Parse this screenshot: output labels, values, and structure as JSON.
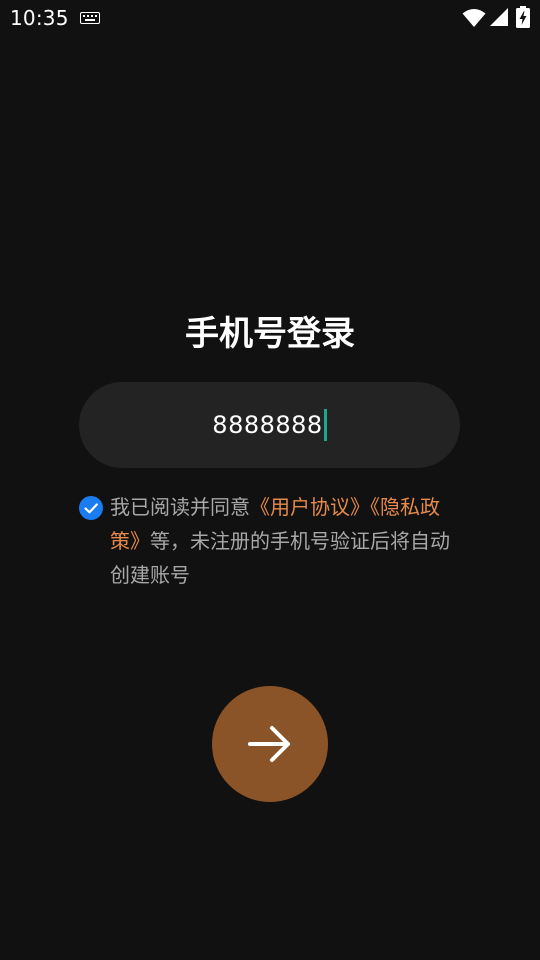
{
  "status_bar": {
    "time": "10:35",
    "icons": [
      "keyboard-icon",
      "wifi-icon",
      "cellular-signal-icon",
      "battery-charging-icon"
    ]
  },
  "login": {
    "title": "手机号登录",
    "phone_value": "8888888",
    "agreement": {
      "checked": true,
      "prefix": "我已阅读并同意",
      "user_agreement_link": "《用户协议》",
      "privacy_policy_link": "《隐私政策》",
      "suffix": "等，未注册的手机号验证后将自动创建账号"
    },
    "next_icon": "arrow-right-icon"
  },
  "colors": {
    "background": "#111111",
    "input_background": "#232323",
    "link": "#e58a4a",
    "button": "#8b5428",
    "checkbox": "#1a7cf0",
    "caret": "#1aa890"
  }
}
